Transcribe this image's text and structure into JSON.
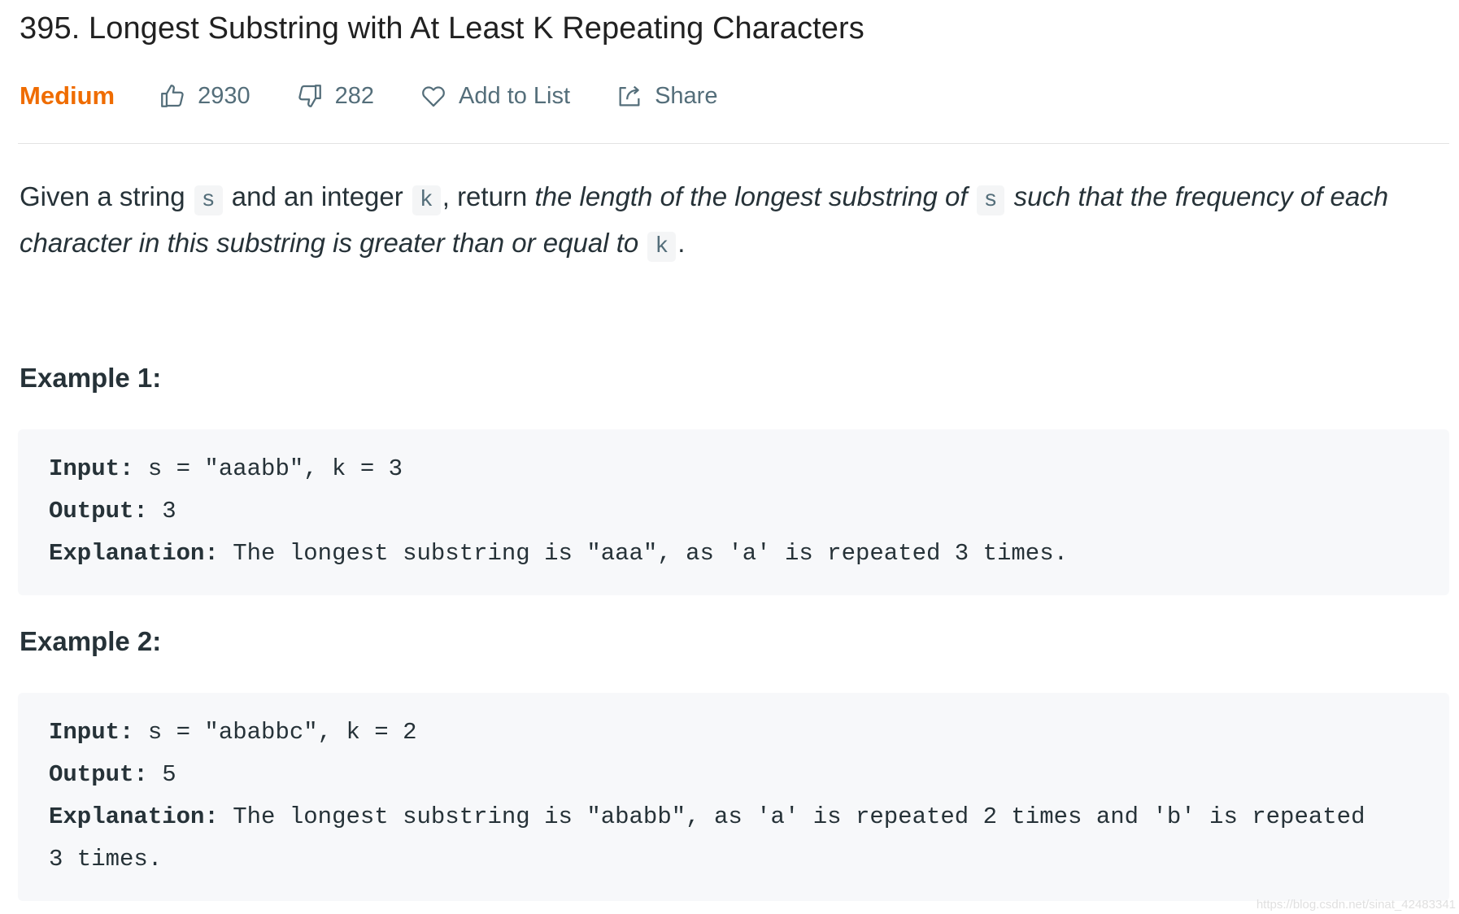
{
  "problem": {
    "title": "395. Longest Substring with At Least K Repeating Characters",
    "difficulty": "Medium"
  },
  "actions": {
    "likes": "2930",
    "dislikes": "282",
    "add_to_list": "Add to List",
    "share": "Share"
  },
  "icons": [
    "thumbs-up-icon",
    "thumbs-down-icon",
    "heart-icon",
    "share-icon"
  ],
  "colors": {
    "difficulty_medium": "#ef6c00",
    "meta_text": "#546e7a",
    "code_bg": "#f7f8fa"
  },
  "description": {
    "p1": "Given a string ",
    "code_s": "s",
    "p2": " and an integer ",
    "code_k": "k",
    "p3": ", return ",
    "em1": "the length of the longest substring of ",
    "code_s2": "s",
    "em2": " such that the frequency of each character in this substring is greater than or equal to ",
    "code_k2": "k",
    "p4": "."
  },
  "examples": [
    {
      "title": "Example 1:",
      "input_label": "Input:",
      "input": " s = \"aaabb\", k = 3",
      "output_label": "Output:",
      "output": " 3",
      "explanation_label": "Explanation:",
      "explanation": " The longest substring is \"aaa\", as 'a' is repeated 3 times."
    },
    {
      "title": "Example 2:",
      "input_label": "Input:",
      "input": " s = \"ababbc\", k = 2",
      "output_label": "Output:",
      "output": " 5",
      "explanation_label": "Explanation:",
      "explanation": " The longest substring is \"ababb\", as 'a' is repeated 2 times and 'b' is repeated",
      "explanation_cont": "3 times."
    }
  ],
  "watermark": "https://blog.csdn.net/sinat_42483341"
}
